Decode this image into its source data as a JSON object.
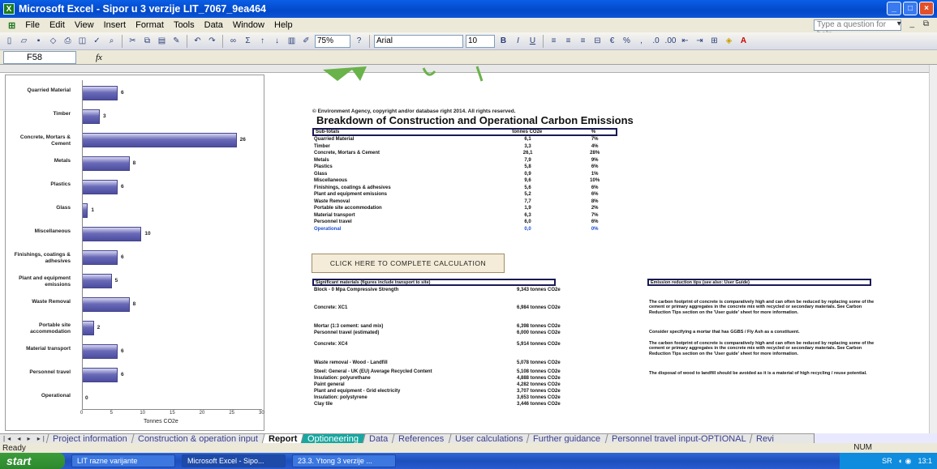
{
  "window": {
    "title": "Microsoft Excel - Sipor u 3 verzije LIT_7067_9ea464"
  },
  "menu": [
    "File",
    "Edit",
    "View",
    "Insert",
    "Format",
    "Tools",
    "Data",
    "Window",
    "Help"
  ],
  "help_placeholder": "Type a question for help",
  "toolbar": {
    "zoom": "75%",
    "font": "Arial",
    "font_size": "10"
  },
  "formula_bar": {
    "name_box": "F58",
    "fx": "fx"
  },
  "chart_data": {
    "type": "bar",
    "orientation": "horizontal",
    "categories": [
      "Quarried Material",
      "Timber",
      "Concrete, Mortars & Cement",
      "Metals",
      "Plastics",
      "Glass",
      "Miscellaneous",
      "Finishings, coatings & adhesives",
      "Plant and equipment emissions",
      "Waste Removal",
      "Portable site accommodation",
      "Material transport",
      "Personnel travel",
      "Operational"
    ],
    "values": [
      6,
      3,
      26,
      8,
      6,
      1,
      10,
      6,
      5,
      8,
      2,
      6,
      6,
      0
    ],
    "value_labels": [
      "6",
      "3",
      "26",
      "8",
      "6",
      "1",
      "10",
      "6",
      "5",
      "8",
      "2",
      "6",
      "6",
      "0"
    ],
    "xlabel": "Tonnes CO2e",
    "x_ticks": [
      "0",
      "5",
      "10",
      "15",
      "20",
      "25",
      "30"
    ],
    "xlim": [
      0,
      30
    ],
    "bar_color": "#6a6ab8"
  },
  "copyright": "© Environment Agency, copyright and/or database right 2014. All rights reserved.",
  "breakdown": {
    "title": "Breakdown of Construction and Operational Carbon Emissions",
    "headers": [
      "Sub-totals",
      "tonnes CO2e",
      "%"
    ],
    "rows": [
      [
        "Quarried Material",
        "6,1",
        "7%"
      ],
      [
        "Timber",
        "3,3",
        "4%"
      ],
      [
        "Concrete, Mortars & Cement",
        "26,1",
        "28%"
      ],
      [
        "Metals",
        "7,9",
        "9%"
      ],
      [
        "Plastics",
        "5,8",
        "6%"
      ],
      [
        "Glass",
        "0,9",
        "1%"
      ],
      [
        "Miscellaneous",
        "9,6",
        "10%"
      ],
      [
        "Finishings, coatings & adhesives",
        "5,6",
        "6%"
      ],
      [
        "Plant and equipment emissions",
        "5,2",
        "6%"
      ],
      [
        "Waste Removal",
        "7,7",
        "8%"
      ],
      [
        "Portable site accommodation",
        "1,9",
        "2%"
      ],
      [
        "Material transport",
        "6,3",
        "7%"
      ],
      [
        "Personnel travel",
        "6,0",
        "6%"
      ],
      [
        "Operational",
        "0,0",
        "0%"
      ]
    ]
  },
  "calc_button": "CLICK HERE TO COMPLETE CALCULATION",
  "significant": {
    "header": "Significant materials (figures include transport to site)",
    "rows": [
      [
        "Block - 0 Mpa Compressive Strength",
        "9,343 tonnes CO2e"
      ],
      [
        "Concrete: XC1",
        "6,984 tonnes CO2e"
      ],
      [
        "Mortar (1:3 cement: sand mix)",
        "6,398 tonnes CO2e"
      ],
      [
        "Personnel travel (estimated)",
        "6,000 tonnes CO2e"
      ],
      [
        "Concrete: XC4",
        "5,914 tonnes CO2e"
      ],
      [
        "Waste removal - Wood - Landfill",
        "5,078 tonnes CO2e"
      ],
      [
        "Steel: General - UK (EU) Average Recycled Content",
        "5,108 tonnes CO2e"
      ],
      [
        "Insulation: polyurethane",
        "4,888 tonnes CO2e"
      ],
      [
        "Paint general",
        "4,282 tonnes CO2e"
      ],
      [
        "Plant and equipment - Grid electricity",
        "3,707 tonnes CO2e"
      ],
      [
        "Insulation: polystyrene",
        "3,653 tonnes CO2e"
      ],
      [
        "Clay tile",
        "3,446 tonnes CO2e"
      ]
    ]
  },
  "tips": {
    "header": "Emission reduction tips (see also: User Guide)",
    "items": [
      "The carbon footprint of concrete is comparatively high and can often be reduced by replacing some of the cement or primary aggregates in the concrete mix with recycled or secondary materials. See Carbon Reduction Tips section on the 'User guide' sheet for more information.",
      "Consider specifying a mortar that has GGBS / Fly Ash as a constituent.",
      "The carbon footprint of concrete is comparatively high and can often be reduced by replacing some of the cement or primary aggregates in the concrete mix with recycled or secondary materials. See Carbon Reduction Tips section on the 'User guide' sheet for more information.",
      "The disposal of wood to landfill should be avoided as it is a material of high recycling / reuse potential."
    ]
  },
  "sheet_tabs": [
    "Project information",
    "Construction & operation input",
    "Report",
    "Optioneering",
    "Data",
    "References",
    "User calculations",
    "Further guidance",
    "Personnel travel input-OPTIONAL",
    "Revi"
  ],
  "status": {
    "ready": "Ready",
    "num": "NUM"
  },
  "taskbar": {
    "start": "start",
    "items": [
      "LIT razne varijante",
      "Microsoft Excel - Sipo...",
      "23.3. Ytong 3 verzije ..."
    ],
    "lang": "SR",
    "time": "13:1"
  }
}
